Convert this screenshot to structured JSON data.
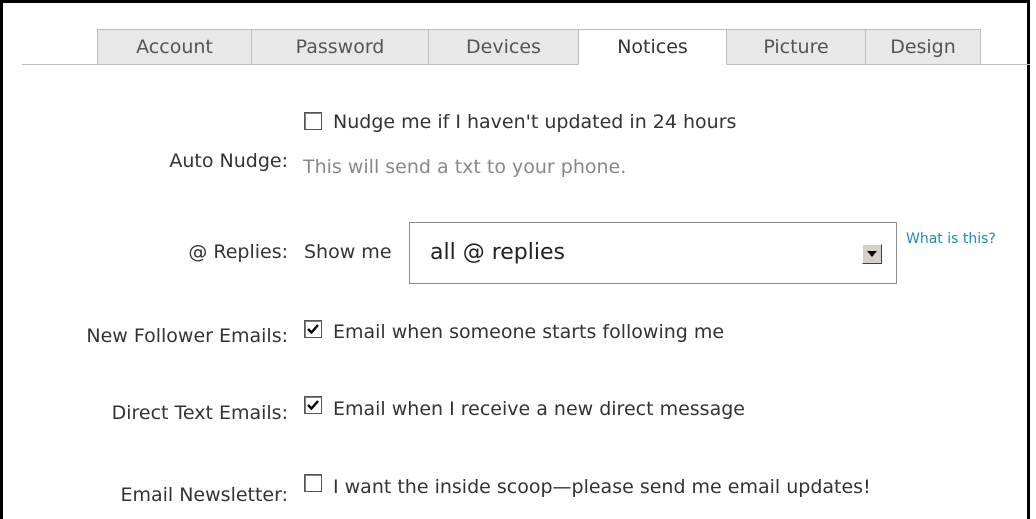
{
  "tabs": [
    {
      "label": "Account",
      "active": false
    },
    {
      "label": "Password",
      "active": false
    },
    {
      "label": "Devices",
      "active": false
    },
    {
      "label": "Notices",
      "active": true
    },
    {
      "label": "Picture",
      "active": false
    },
    {
      "label": "Design",
      "active": false
    }
  ],
  "auto_nudge": {
    "label": "Auto Nudge:",
    "checkbox_label": "Nudge me if I haven't updated in 24 hours",
    "checked": false,
    "hint": "This will send a txt to your phone."
  },
  "replies": {
    "label": "@ Replies:",
    "prefix": "Show me",
    "selected": "all @ replies",
    "help_link": "What is this?"
  },
  "new_follower": {
    "label": "New Follower Emails:",
    "checkbox_label": "Email when someone starts following me",
    "checked": true
  },
  "direct_text": {
    "label": "Direct Text Emails:",
    "checkbox_label": "Email when I receive a new direct message",
    "checked": true
  },
  "newsletter": {
    "label": "Email Newsletter:",
    "checkbox_label": "I want the inside scoop—please send me email updates!",
    "checked": false
  }
}
